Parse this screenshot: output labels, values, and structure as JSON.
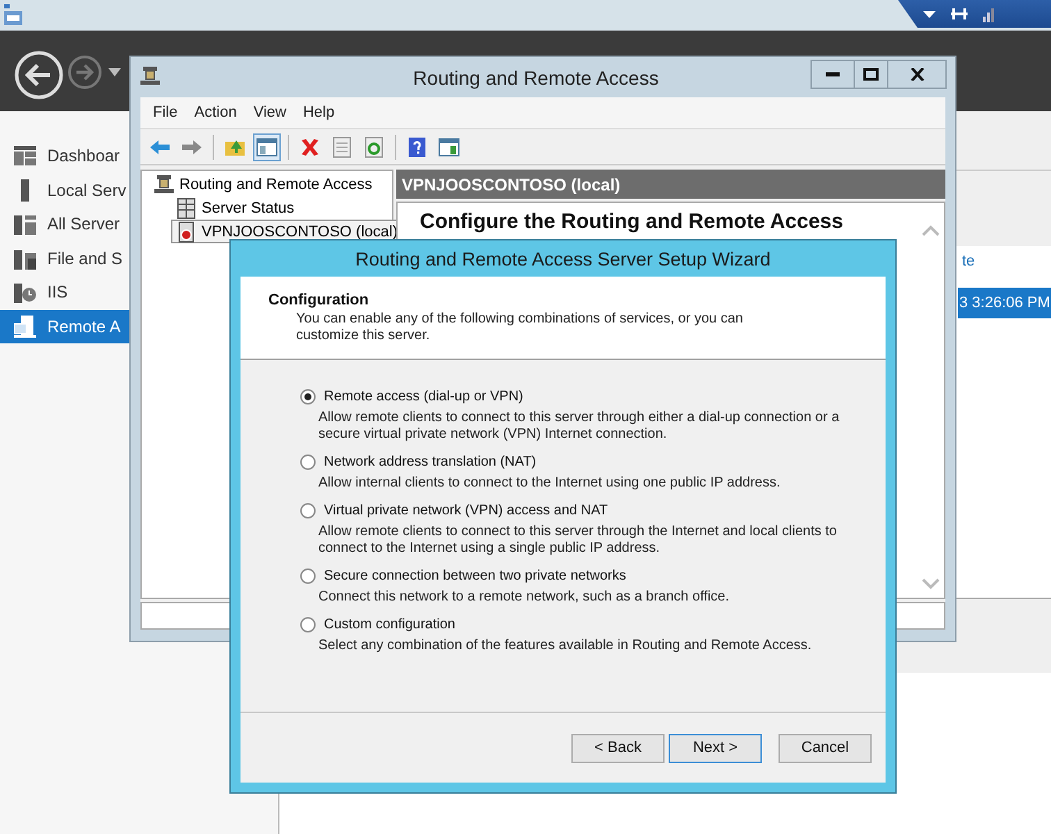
{
  "server_manager": {
    "sidebar": {
      "items": [
        {
          "label": "Dashboar",
          "kind": "dashboard",
          "selected": false
        },
        {
          "label": "Local Serv",
          "kind": "server",
          "selected": false
        },
        {
          "label": "All Server",
          "kind": "servers",
          "selected": false
        },
        {
          "label": "File and S",
          "kind": "files",
          "selected": false
        },
        {
          "label": "IIS",
          "kind": "iis",
          "selected": false
        },
        {
          "label": "Remote A",
          "kind": "remote",
          "selected": true
        }
      ]
    },
    "list": {
      "column_1": "te",
      "rows": [
        {
          "text": "3 3:26:06 PM",
          "selected": true
        }
      ]
    }
  },
  "rras_window": {
    "title": "Routing and Remote Access",
    "menu": [
      "File",
      "Action",
      "View",
      "Help"
    ],
    "toolbar": [
      {
        "kind": "back",
        "pressed": false
      },
      {
        "kind": "forward",
        "pressed": false
      },
      {
        "kind": "up",
        "pressed": false
      },
      {
        "kind": "console",
        "pressed": true
      },
      {
        "kind": "delete",
        "pressed": false
      },
      {
        "kind": "properties",
        "pressed": false
      },
      {
        "kind": "refresh",
        "pressed": false
      },
      {
        "kind": "help",
        "pressed": false
      },
      {
        "kind": "view",
        "pressed": false
      }
    ],
    "tree": [
      {
        "label": "Routing and Remote Access",
        "kind": "root",
        "selected": false,
        "children": [
          {
            "label": "Server Status",
            "kind": "status",
            "selected": false
          },
          {
            "label": "VPNJOOSCONTOSO (local)",
            "kind": "server",
            "selected": true
          }
        ]
      }
    ],
    "pane_header": "VPNJOOSCONTOSO (local)",
    "pane_heading": "Configure the Routing and Remote Access"
  },
  "wizard": {
    "title": "Routing and Remote Access Server Setup Wizard",
    "section_title": "Configuration",
    "section_text": "You can enable any of the following combinations of services, or you can customize this server.",
    "options": [
      {
        "label": "Remote access (dial-up or VPN)",
        "description": "Allow remote clients to connect to this server through either a dial-up connection or a secure virtual private network (VPN) Internet connection.",
        "selected": true
      },
      {
        "label": "Network address translation (NAT)",
        "description": "Allow internal clients to connect to the Internet using one public IP address.",
        "selected": false
      },
      {
        "label": "Virtual private network (VPN) access and NAT",
        "description": "Allow remote clients to connect to this server through the Internet and local clients to connect to the Internet using a single public IP address.",
        "selected": false
      },
      {
        "label": "Secure connection between two private networks",
        "description": "Connect this network to a remote network, such as a branch office.",
        "selected": false
      },
      {
        "label": "Custom configuration",
        "description": "Select any combination of the features available in Routing and Remote Access.",
        "selected": false
      }
    ],
    "buttons": [
      {
        "label": "< Back",
        "default": false
      },
      {
        "label": "Next >",
        "default": true
      },
      {
        "label": "Cancel",
        "default": false
      }
    ]
  }
}
